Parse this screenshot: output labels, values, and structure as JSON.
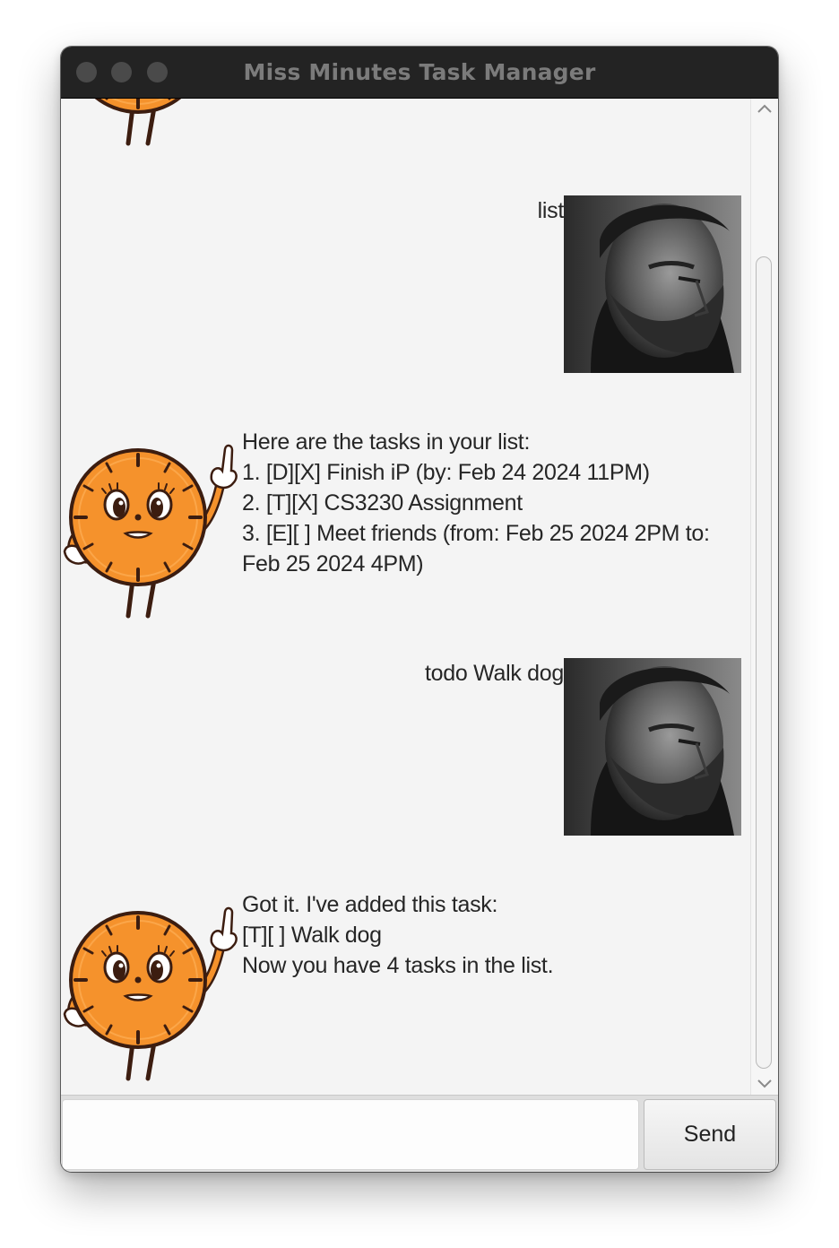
{
  "window": {
    "title": "Miss Minutes Task Manager"
  },
  "messages": [
    {
      "sender": "user",
      "text": "list",
      "avatar": "user-photo"
    },
    {
      "sender": "bot",
      "text": "Here are the tasks in your list:\n1. [D][X] Finish iP (by: Feb 24 2024 11PM)\n2. [T][X] CS3230 Assignment\n3. [E][ ] Meet friends (from: Feb 25 2024 2PM to:\nFeb 25 2024 4PM)",
      "avatar": "miss-minutes-clock"
    },
    {
      "sender": "user",
      "text": "todo Walk dog",
      "avatar": "user-photo"
    },
    {
      "sender": "bot",
      "text": "Got it. I've added this task:\n[T][ ] Walk dog\nNow you have 4 tasks in the list.",
      "avatar": "miss-minutes-clock"
    }
  ],
  "input": {
    "value": "",
    "placeholder": ""
  },
  "send_button": {
    "label": "Send"
  },
  "colors": {
    "titlebar": "#232323",
    "title_text": "#7b7b7b",
    "chat_background": "#f4f4f4",
    "mascot_orange": "#f5922c",
    "mascot_dark": "#3c1d10"
  }
}
